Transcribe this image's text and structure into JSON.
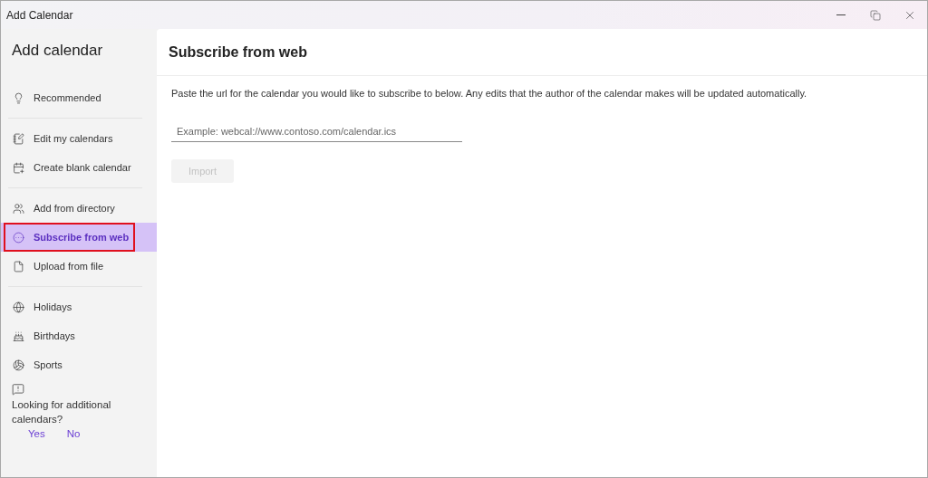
{
  "window": {
    "title": "Add Calendar"
  },
  "sidebar": {
    "title": "Add calendar",
    "groups": [
      [
        {
          "label": "Recommended",
          "selected": false,
          "annotated": false
        }
      ],
      [
        {
          "label": "Edit my calendars",
          "selected": false,
          "annotated": false
        },
        {
          "label": "Create blank calendar",
          "selected": false,
          "annotated": false
        }
      ],
      [
        {
          "label": "Add from directory",
          "selected": false,
          "annotated": false
        },
        {
          "label": "Subscribe from web",
          "selected": true,
          "annotated": true
        },
        {
          "label": "Upload from file",
          "selected": false,
          "annotated": false
        }
      ],
      [
        {
          "label": "Holidays",
          "selected": false,
          "annotated": false
        },
        {
          "label": "Birthdays",
          "selected": false,
          "annotated": false
        },
        {
          "label": "Sports",
          "selected": false,
          "annotated": false
        }
      ]
    ],
    "feedback": {
      "question": "Looking for additional calendars?",
      "answers": [
        "Yes",
        "No"
      ]
    }
  },
  "main": {
    "title": "Subscribe from web",
    "description": "Paste the url for the calendar you would like to subscribe to below. Any edits that the author of the calendar makes will be updated automatically.",
    "url_field": {
      "placeholder": "Example: webcal://www.contoso.com/calendar.ics"
    },
    "import_button": {
      "label": "Import",
      "disabled": true
    }
  }
}
